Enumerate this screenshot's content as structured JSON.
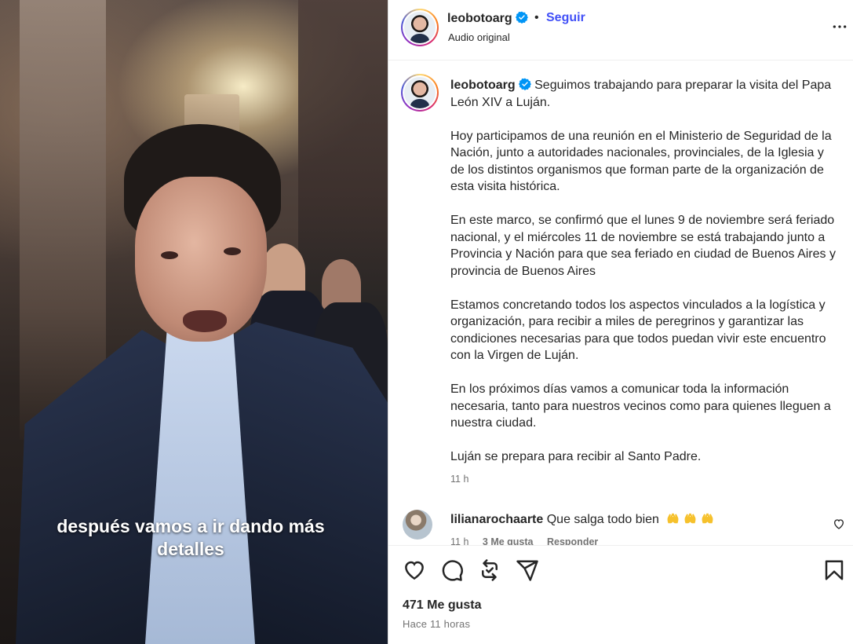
{
  "video": {
    "caption_line1": "después vamos a ir dando más",
    "caption_line2": "detalles"
  },
  "header": {
    "username": "leobotoarg",
    "verified": true,
    "separator": "•",
    "follow_label": "Seguir",
    "audio_label": "Audio original",
    "more_icon": "more-options-icon"
  },
  "caption": {
    "username": "leobotoarg",
    "paragraphs": [
      "Seguimos trabajando para preparar la visita del Papa León XIV a Luján.",
      "Hoy participamos de una reunión en el Ministerio de Seguridad de la Nación, junto a autoridades nacionales, provinciales, de la Iglesia y de los distintos organismos que forman parte de la organización de esta visita histórica.",
      "En este marco, se confirmó que el lunes 9 de noviembre será feriado nacional, y el miércoles 11 de noviembre se está trabajando junto a Provincia y Nación para que sea feriado en ciudad de Buenos Aires y provincia de Buenos Aires",
      "Estamos concretando todos los aspectos vinculados a la logística y organización, para recibir a miles de peregrinos y garantizar las condiciones necesarias para que todos puedan vivir este encuentro con la Virgen de Luján.",
      "En los próximos días vamos a comunicar toda la información necesaria, tanto para nuestros vecinos como para quienes lleguen a nuestra ciudad.",
      "Luján se prepara para recibir al Santo Padre."
    ],
    "time": "11 h"
  },
  "comment": {
    "username": "lilianarochaarte",
    "text": "Que salga todo bien",
    "emojis": [
      "raising-hands",
      "raising-hands",
      "raising-hands"
    ],
    "time": "11 h",
    "likes": "3 Me gusta",
    "reply_label": "Responder"
  },
  "actions": {
    "icons": [
      "heart-icon",
      "comment-icon",
      "repost-icon",
      "share-icon",
      "bookmark-icon"
    ],
    "likes": "471 Me gusta",
    "posted": "Hace 11 horas"
  },
  "colors": {
    "accent": "#4150f7",
    "verified": "#0095f6",
    "secondary_text": "#737373",
    "text": "#262626"
  }
}
